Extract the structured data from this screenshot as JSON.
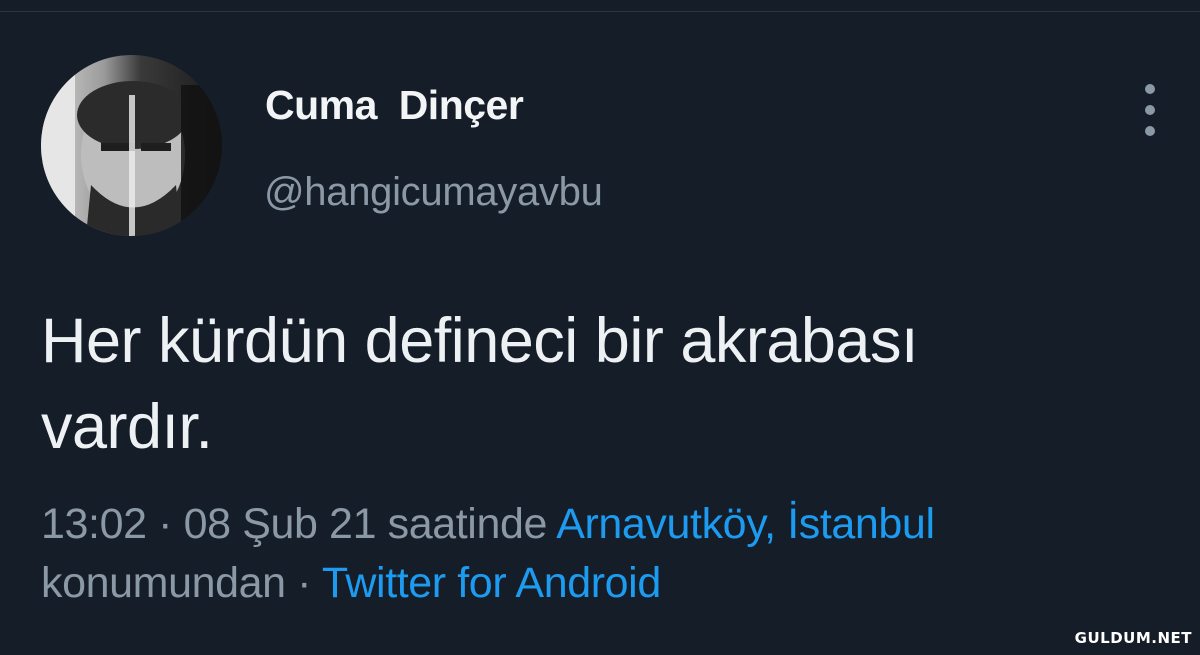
{
  "tweet": {
    "author": {
      "display_name": "Cuma  Dinçer",
      "username": "@hangicumayavbu",
      "avatar_icon": "profile-photo"
    },
    "more_icon": "more-vertical-icon",
    "text_line1": "Her kürdün defineci bir akrabası",
    "text_line2": "vardır.",
    "timestamp": "13:02 · 08 Şub 21 saatinde",
    "location": "Arnavutköy, İstanbul",
    "location_suffix": "konumundan ·",
    "source": "Twitter for Android"
  },
  "watermark": "GULDUM.NET",
  "colors": {
    "background": "#141d28",
    "text": "#eef1f4",
    "secondary": "#8b98a5",
    "link": "#1d9bf0"
  }
}
